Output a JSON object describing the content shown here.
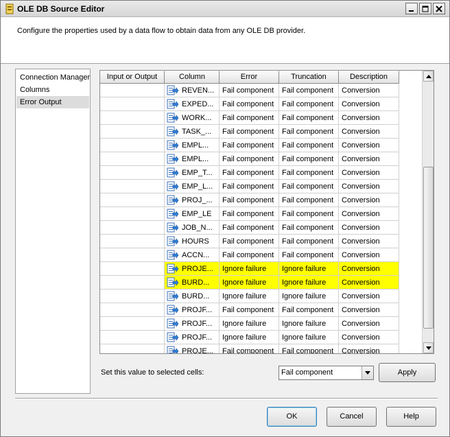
{
  "window": {
    "title": "OLE DB Source Editor",
    "description": "Configure the properties used by a data flow to obtain data from any OLE DB provider."
  },
  "nav": {
    "items": [
      "Connection Manager",
      "Columns",
      "Error Output"
    ],
    "selected_index": 2
  },
  "grid": {
    "headers": [
      "Input or Output",
      "Column",
      "Error",
      "Truncation",
      "Description"
    ],
    "rows": [
      {
        "io": "",
        "column": "REVEN...",
        "error": "Fail component",
        "truncation": "Fail component",
        "description": "Conversion",
        "highlighted": false
      },
      {
        "io": "",
        "column": "EXPED...",
        "error": "Fail component",
        "truncation": "Fail component",
        "description": "Conversion",
        "highlighted": false
      },
      {
        "io": "",
        "column": "WORK...",
        "error": "Fail component",
        "truncation": "Fail component",
        "description": "Conversion",
        "highlighted": false
      },
      {
        "io": "",
        "column": "TASK_...",
        "error": "Fail component",
        "truncation": "Fail component",
        "description": "Conversion",
        "highlighted": false
      },
      {
        "io": "",
        "column": "EMPL...",
        "error": "Fail component",
        "truncation": "Fail component",
        "description": "Conversion",
        "highlighted": false
      },
      {
        "io": "",
        "column": "EMPL...",
        "error": "Fail component",
        "truncation": "Fail component",
        "description": "Conversion",
        "highlighted": false
      },
      {
        "io": "",
        "column": "EMP_T...",
        "error": "Fail component",
        "truncation": "Fail component",
        "description": "Conversion",
        "highlighted": false
      },
      {
        "io": "",
        "column": "EMP_L...",
        "error": "Fail component",
        "truncation": "Fail component",
        "description": "Conversion",
        "highlighted": false
      },
      {
        "io": "",
        "column": "PROJ_...",
        "error": "Fail component",
        "truncation": "Fail component",
        "description": "Conversion",
        "highlighted": false
      },
      {
        "io": "",
        "column": "EMP_LE",
        "error": "Fail component",
        "truncation": "Fail component",
        "description": "Conversion",
        "highlighted": false
      },
      {
        "io": "",
        "column": "JOB_N...",
        "error": "Fail component",
        "truncation": "Fail component",
        "description": "Conversion",
        "highlighted": false
      },
      {
        "io": "",
        "column": "HOURS",
        "error": "Fail component",
        "truncation": "Fail component",
        "description": "Conversion",
        "highlighted": false
      },
      {
        "io": "",
        "column": "ACCN...",
        "error": "Fail component",
        "truncation": "Fail component",
        "description": "Conversion",
        "highlighted": false
      },
      {
        "io": "",
        "column": "PROJE...",
        "error": "Ignore failure",
        "truncation": "Ignore failure",
        "description": "Conversion",
        "highlighted": true
      },
      {
        "io": "",
        "column": "BURD...",
        "error": "Ignore failure",
        "truncation": "Ignore failure",
        "description": "Conversion",
        "highlighted": true
      },
      {
        "io": "",
        "column": "BURD...",
        "error": "Ignore failure",
        "truncation": "Ignore failure",
        "description": "Conversion",
        "highlighted": false
      },
      {
        "io": "",
        "column": "PROJF...",
        "error": "Fail component",
        "truncation": "Fail component",
        "description": "Conversion",
        "highlighted": false
      },
      {
        "io": "",
        "column": "PROJF...",
        "error": "Ignore failure",
        "truncation": "Ignore failure",
        "description": "Conversion",
        "highlighted": false
      },
      {
        "io": "",
        "column": "PROJF...",
        "error": "Ignore failure",
        "truncation": "Ignore failure",
        "description": "Conversion",
        "highlighted": false
      },
      {
        "io": "",
        "column": "PROJE...",
        "error": "Fail component",
        "truncation": "Fail component",
        "description": "Conversion",
        "highlighted": false
      }
    ]
  },
  "set_value": {
    "label": "Set this value to selected cells:",
    "selected": "Fail component",
    "apply_label": "Apply"
  },
  "footer": {
    "ok_label": "OK",
    "cancel_label": "Cancel",
    "help_label": "Help"
  },
  "colors": {
    "highlight": "#ffff00",
    "window_bg": "#f0f0f0",
    "nav_selected": "#dcdcdc"
  },
  "icons": {
    "title": "package-icon",
    "column": "column-icon",
    "minimize": "minimize-icon",
    "maximize": "maximize-icon",
    "close": "close-icon",
    "dropdown": "chevron-down-icon",
    "scroll_up": "chevron-up-icon",
    "scroll_down": "chevron-down-icon"
  }
}
